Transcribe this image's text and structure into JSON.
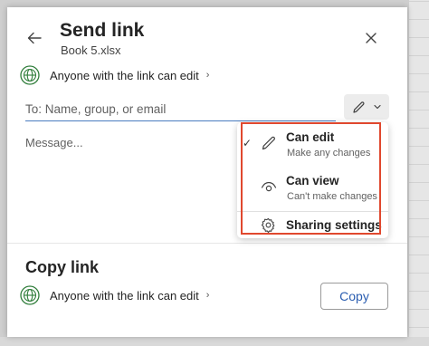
{
  "dialog": {
    "title": "Send link",
    "subtitle": "Book 5.xlsx",
    "permission_text": "Anyone with the link can edit",
    "to_placeholder": "To: Name, group, or email",
    "message_placeholder": "Message..."
  },
  "dropdown": {
    "items": [
      {
        "label": "Can edit",
        "sublabel": "Make any changes",
        "selected": true,
        "icon": "pencil-icon"
      },
      {
        "label": "Can view",
        "sublabel": "Can't make changes",
        "selected": false,
        "icon": "eye-icon"
      }
    ],
    "settings_label": "Sharing settings",
    "check_glyph": "✓",
    "highlight_color": "#e0482e"
  },
  "copy_link": {
    "title": "Copy link",
    "permission_text": "Anyone with the link can edit",
    "button_label": "Copy"
  },
  "colors": {
    "accent": "#2a5db0",
    "globe": "#2f7d3a",
    "input_underline": "#4a7cc0"
  }
}
